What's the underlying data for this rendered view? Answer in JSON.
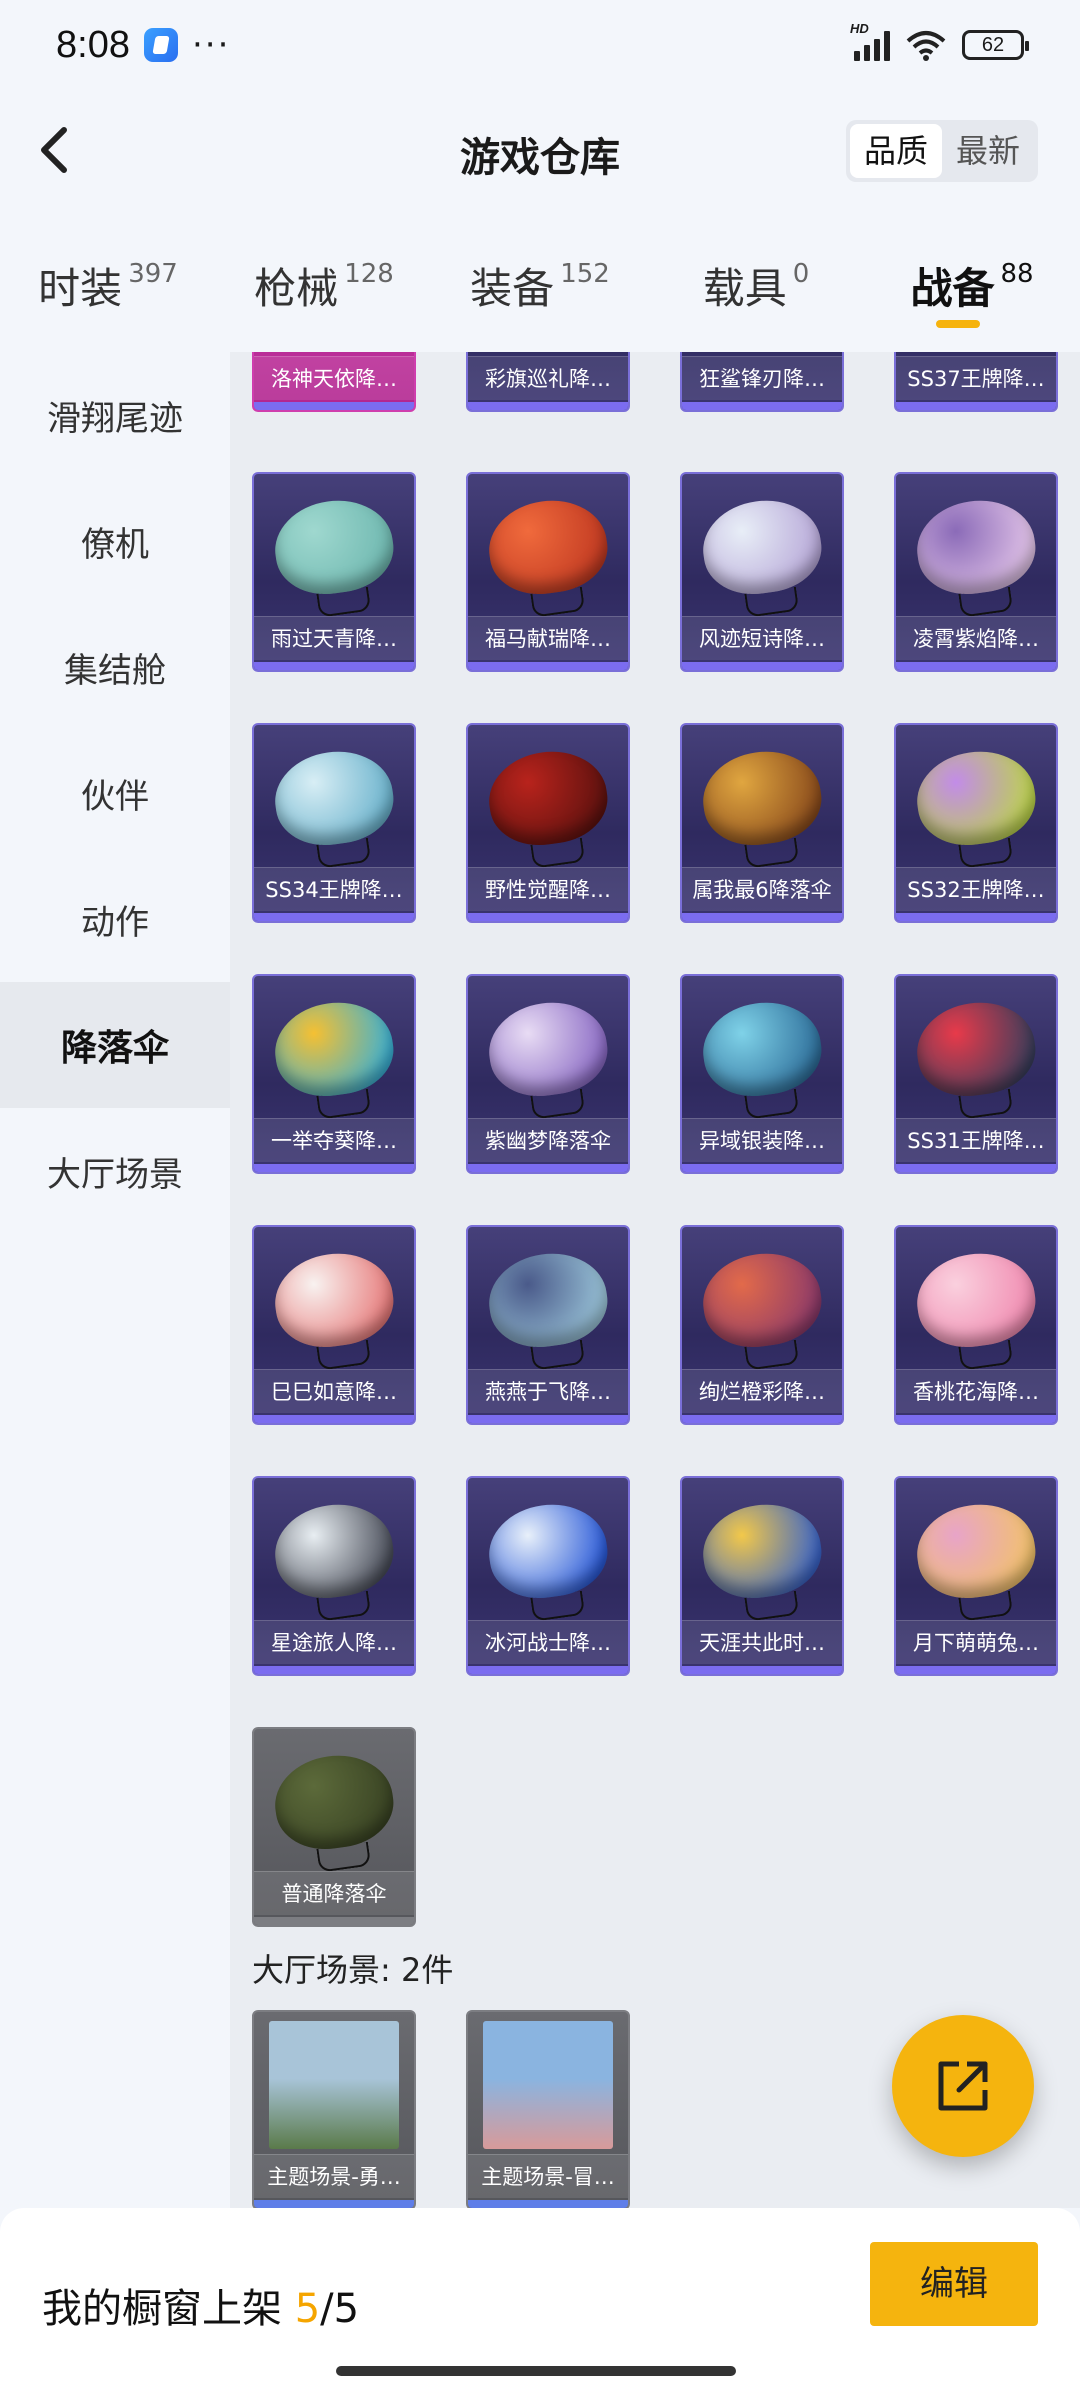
{
  "status_bar": {
    "time": "8:08",
    "more": "···",
    "network_badge": "HD",
    "battery": "62"
  },
  "header": {
    "title": "游戏仓库",
    "sort_options": [
      "品质",
      "最新"
    ],
    "sort_selected": "品质"
  },
  "tabs": [
    {
      "label": "时装",
      "count": "397"
    },
    {
      "label": "枪械",
      "count": "128"
    },
    {
      "label": "装备",
      "count": "152"
    },
    {
      "label": "载具",
      "count": "0"
    },
    {
      "label": "战备",
      "count": "88"
    }
  ],
  "active_tab": "战备",
  "sidebar": {
    "items": [
      {
        "label": "滑翔尾迹"
      },
      {
        "label": "僚机"
      },
      {
        "label": "集结舱"
      },
      {
        "label": "伙伴"
      },
      {
        "label": "动作"
      },
      {
        "label": "降落伞"
      },
      {
        "label": "大厅场景"
      }
    ],
    "active": "降落伞"
  },
  "grid": {
    "partial_row": [
      "洛神天依降…",
      "彩旗巡礼降…",
      "狂鲨锋刃降…",
      "SS37王牌降…"
    ],
    "items": [
      {
        "name": "雨过天青降…",
        "colors": [
          "#9fd8cf",
          "#6fb8b0"
        ]
      },
      {
        "name": "福马献瑞降…",
        "colors": [
          "#f06a3c",
          "#c13a22"
        ]
      },
      {
        "name": "风迹短诗降…",
        "colors": [
          "#e8eef7",
          "#b7a8d8"
        ]
      },
      {
        "name": "凌霄紫焰降…",
        "colors": [
          "#8b6bb8",
          "#e2c4e8"
        ]
      },
      {
        "name": "SS34王牌降…",
        "colors": [
          "#d8eef5",
          "#6ab2cc"
        ]
      },
      {
        "name": "野性觉醒降…",
        "colors": [
          "#b8231c",
          "#5e120f"
        ]
      },
      {
        "name": "属我最6降落伞",
        "colors": [
          "#e0a640",
          "#8a4b1c"
        ]
      },
      {
        "name": "SS32王牌降…",
        "colors": [
          "#c28ce8",
          "#bcd44a"
        ]
      },
      {
        "name": "一举夺葵降…",
        "colors": [
          "#f5c032",
          "#3bb0d4"
        ]
      },
      {
        "name": "紫幽梦降落伞",
        "colors": [
          "#e8dcf4",
          "#8a6ac4"
        ]
      },
      {
        "name": "异域银装降…",
        "colors": [
          "#7fd2e8",
          "#2e6e9a"
        ]
      },
      {
        "name": "SS31王牌降…",
        "colors": [
          "#e83a4a",
          "#3a3e5c"
        ]
      },
      {
        "name": "巳巳如意降…",
        "colors": [
          "#f8f2f0",
          "#e77a7a"
        ]
      },
      {
        "name": "燕燕于飞降…",
        "colors": [
          "#4a5a8a",
          "#9ac4d8"
        ]
      },
      {
        "name": "绚烂橙彩降…",
        "colors": [
          "#e26a4a",
          "#8c3a6a"
        ]
      },
      {
        "name": "香桃花海降…",
        "colors": [
          "#fad0de",
          "#f08ab0"
        ]
      },
      {
        "name": "星途旅人降…",
        "colors": [
          "#e8eef2",
          "#4a4e5a"
        ]
      },
      {
        "name": "冰河战士降…",
        "colors": [
          "#e8f0fa",
          "#2a5ad8"
        ]
      },
      {
        "name": "天涯共此时…",
        "colors": [
          "#f2c84a",
          "#3a64c8"
        ]
      },
      {
        "name": "月下萌萌兔…",
        "colors": [
          "#e8a4c8",
          "#f2c26a"
        ]
      },
      {
        "name": "普通降落伞",
        "colors": [
          "#5c6a3a",
          "#3a4424"
        ],
        "quality": "common"
      }
    ]
  },
  "scene_section": {
    "title": "大厅场景: 2件",
    "items": [
      {
        "name": "主题场景-勇…",
        "colors": [
          "#a8c4d8",
          "#5a7a4a"
        ]
      },
      {
        "name": "主题场景-冒…",
        "colors": [
          "#8ab4e0",
          "#d89a9a"
        ]
      }
    ]
  },
  "fab": {
    "icon": "external-link-icon"
  },
  "footer": {
    "shelf_label": "我的橱窗上架",
    "shelf_current": "5",
    "shelf_total": "/5",
    "edit_label": "编辑"
  },
  "colors": {
    "accent": "#f5b40e",
    "card_border": "#7a6fd8"
  }
}
